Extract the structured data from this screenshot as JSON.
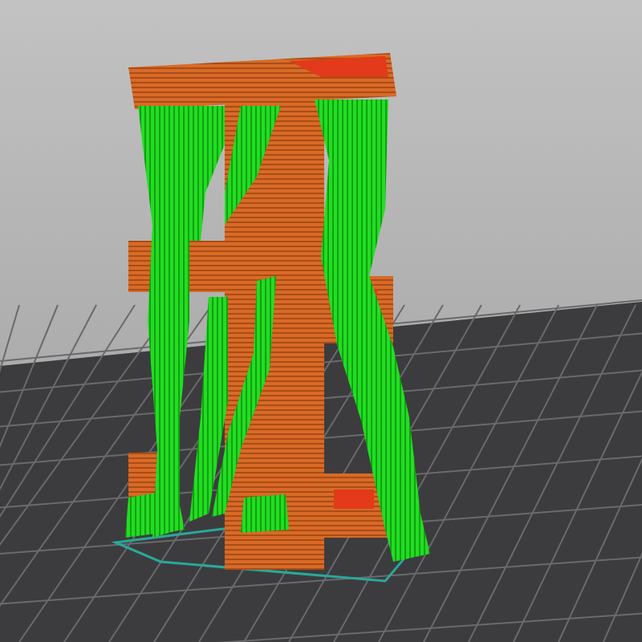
{
  "viewport": {
    "kind": "sliced-preview",
    "show_supports": true,
    "show_bed": true
  }
}
